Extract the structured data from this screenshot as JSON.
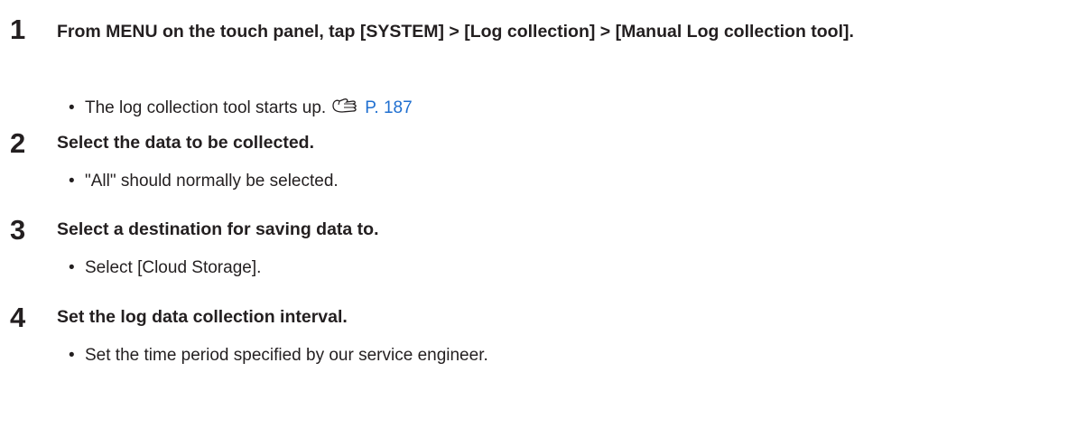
{
  "steps": [
    {
      "number": "1",
      "title": "From MENU on the touch panel, tap [SYSTEM] > [Log collection] > [Manual Log collection tool].",
      "bullet": "The log collection tool starts up.",
      "link": "P. 187",
      "icon": "page-reference-icon"
    },
    {
      "number": "2",
      "title": "Select the data to be collected.",
      "bullet": "\"All\" should normally be selected."
    },
    {
      "number": "3",
      "title": "Select a destination for saving data to.",
      "bullet": "Select [Cloud Storage]."
    },
    {
      "number": "4",
      "title": "Set the log data collection interval.",
      "bullet": "Set the time period specified by our service engineer."
    }
  ],
  "bullet_char": "•"
}
